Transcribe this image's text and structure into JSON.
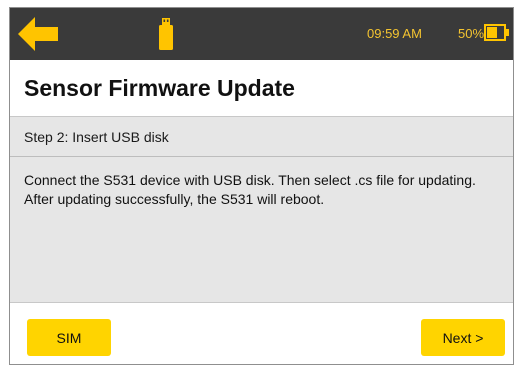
{
  "status_bar": {
    "back_icon": "back-arrow-icon",
    "usb_icon": "usb-drive-icon",
    "time": "09:59 AM",
    "battery_percent": "50%",
    "battery_icon": "battery-half-icon",
    "accent_color": "#f4c430"
  },
  "header": {
    "title": "Sensor Firmware Update"
  },
  "step": {
    "label": "Step 2:  Insert USB disk"
  },
  "content": {
    "message": "Connect the S531 device with USB disk. Then select .cs file for updating. After updating successfully, the S531 will reboot."
  },
  "footer": {
    "sim_label": "SIM",
    "next_label": "Next >",
    "button_color": "#ffd400"
  }
}
